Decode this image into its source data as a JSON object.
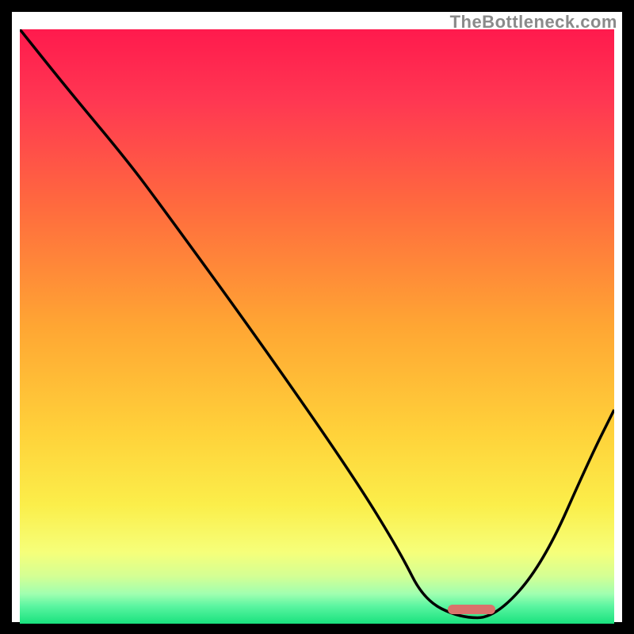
{
  "watermark": "TheBottleneck.com",
  "colors": {
    "gradient_stops": [
      {
        "pct": 0,
        "color": "#ff1a4d"
      },
      {
        "pct": 12,
        "color": "#ff3752"
      },
      {
        "pct": 30,
        "color": "#ff6b3e"
      },
      {
        "pct": 50,
        "color": "#ffa633"
      },
      {
        "pct": 68,
        "color": "#ffd23a"
      },
      {
        "pct": 80,
        "color": "#fbee4a"
      },
      {
        "pct": 88,
        "color": "#f6ff7a"
      },
      {
        "pct": 92,
        "color": "#d4ff94"
      },
      {
        "pct": 95,
        "color": "#a0ffb0"
      },
      {
        "pct": 97,
        "color": "#5cf5a1"
      },
      {
        "pct": 100,
        "color": "#19e27e"
      }
    ],
    "curve": "#000000",
    "marker": "#d9736b"
  },
  "chart_data": {
    "type": "line",
    "title": "",
    "xlabel": "",
    "ylabel": "",
    "xlim": [
      0,
      100
    ],
    "ylim": [
      0,
      100
    ],
    "grid": false,
    "annotations": [
      "TheBottleneck.com"
    ],
    "series": [
      {
        "name": "bottleneck-curve",
        "x": [
          0,
          8,
          18,
          24,
          40,
          56,
          64,
          68,
          74,
          80,
          88,
          96,
          100
        ],
        "y": [
          100,
          90,
          78,
          70,
          48,
          25,
          12,
          4,
          1,
          1,
          10,
          28,
          36
        ]
      }
    ],
    "optimum_marker": {
      "x_start": 72,
      "x_end": 80,
      "y": 0.6
    }
  }
}
